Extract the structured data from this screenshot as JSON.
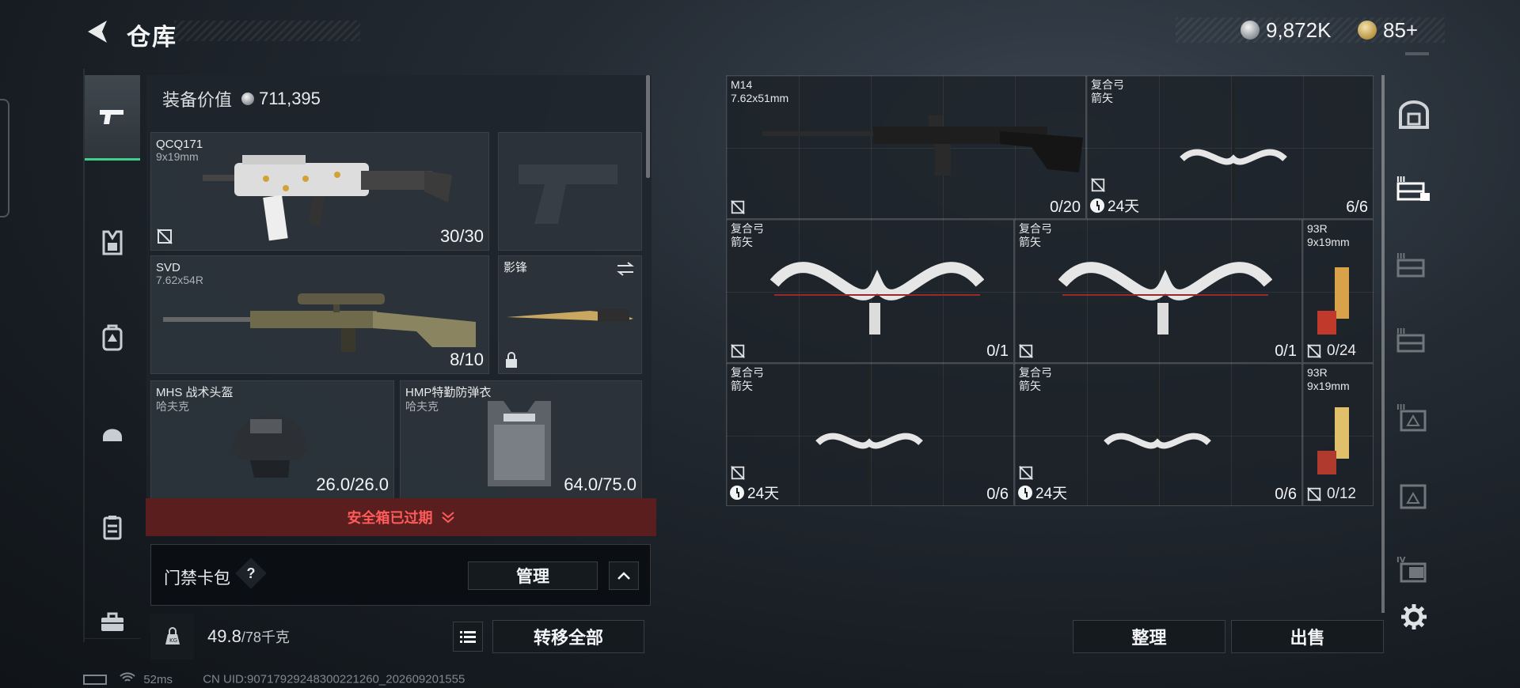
{
  "header": {
    "title": "仓库"
  },
  "currency": {
    "silver": "9,872K",
    "gold": "85+"
  },
  "equipment": {
    "value_label": "装备价值",
    "value": "711,395",
    "slots": [
      {
        "name": "QCQ171",
        "sub": "9x19mm",
        "count": "30/30"
      },
      {
        "name": "",
        "sub": "",
        "count": ""
      },
      {
        "name": "SVD",
        "sub": "7.62x54R",
        "count": "8/10"
      },
      {
        "name": "影锋",
        "sub": "",
        "count": ""
      },
      {
        "name": "MHS 战术头盔",
        "sub": "哈夫克",
        "count": "26.0/26.0"
      },
      {
        "name": "HMP特勤防弹衣",
        "sub": "哈夫克",
        "count": "64.0/75.0"
      }
    ]
  },
  "safebox": {
    "expired_label": "安全箱已过期"
  },
  "keycard": {
    "label": "门禁卡包",
    "help": "?",
    "manage_label": "管理"
  },
  "weight": {
    "current": "49.8",
    "max": "/78千克",
    "transfer_label": "转移全部"
  },
  "status": {
    "ping": "52ms",
    "uid": "CN UID:90717929248300221260_202609201555"
  },
  "warehouse": {
    "items": [
      {
        "name": "M14",
        "sub": "7.62x51mm",
        "count": "0/20",
        "timer": ""
      },
      {
        "name": "复合弓",
        "sub": "箭矢",
        "count": "6/6",
        "timer": "24天"
      },
      {
        "name": "复合弓",
        "sub": "箭矢",
        "count": "0/1",
        "timer": ""
      },
      {
        "name": "复合弓",
        "sub": "箭矢",
        "count": "0/1",
        "timer": ""
      },
      {
        "name": "93R",
        "sub": "9x19mm",
        "count": "0/24",
        "timer": ""
      },
      {
        "name": "复合弓",
        "sub": "箭矢",
        "count": "0/6",
        "timer": "24天"
      },
      {
        "name": "复合弓",
        "sub": "箭矢",
        "count": "0/6",
        "timer": "24天"
      },
      {
        "name": "93R",
        "sub": "9x19mm",
        "count": "0/12",
        "timer": ""
      }
    ],
    "sort_label": "整理",
    "sell_label": "出售",
    "tabs": [
      "III",
      "III",
      "III",
      "III",
      "IV"
    ]
  }
}
